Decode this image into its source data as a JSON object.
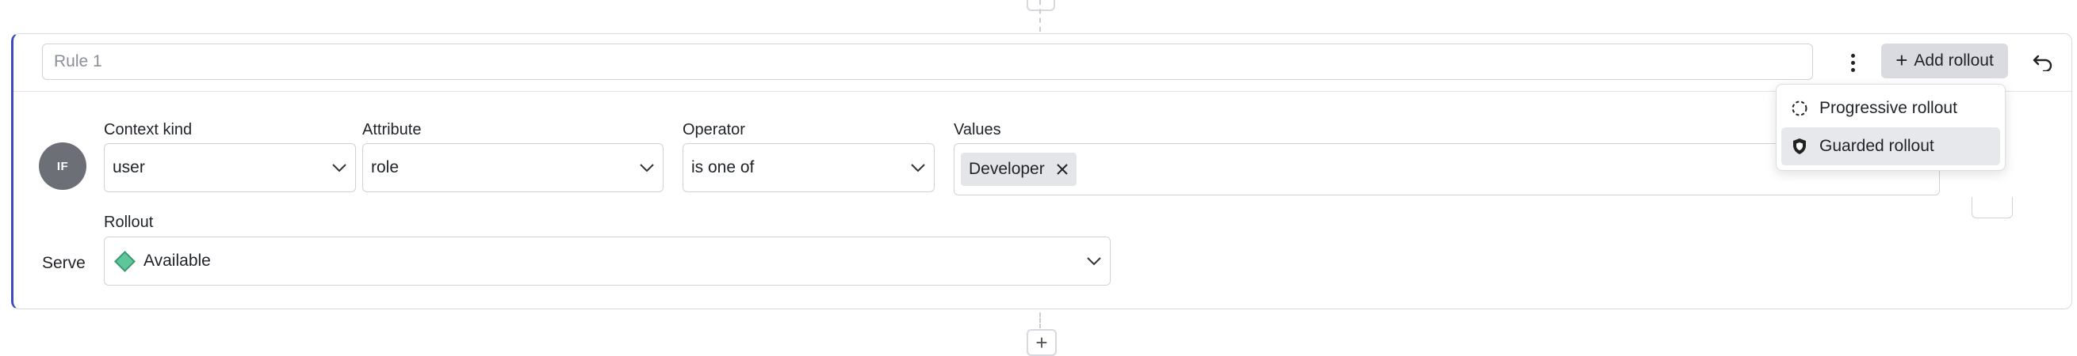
{
  "rule": {
    "name_value": "",
    "name_placeholder": "Rule 1",
    "add_rollout_label": "Add rollout",
    "if_badge": "IF"
  },
  "condition": {
    "context_kind": {
      "label": "Context kind",
      "value": "user"
    },
    "attribute": {
      "label": "Attribute",
      "value": "role"
    },
    "operator": {
      "label": "Operator",
      "value": "is one of"
    },
    "values": {
      "label": "Values",
      "chips": [
        "Developer"
      ]
    }
  },
  "serve": {
    "label": "Serve",
    "rollout_label": "Rollout",
    "variation": "Available",
    "variation_color": "#5fc59a"
  },
  "rollout_menu": {
    "items": [
      {
        "label": "Progressive rollout",
        "icon": "progressive-rollout-icon"
      },
      {
        "label": "Guarded rollout",
        "icon": "shield-icon"
      }
    ]
  },
  "colors": {
    "accent_border": "#3d4bc0",
    "button_bg": "#d9dbe0",
    "badge_bg": "#6c6f76"
  }
}
